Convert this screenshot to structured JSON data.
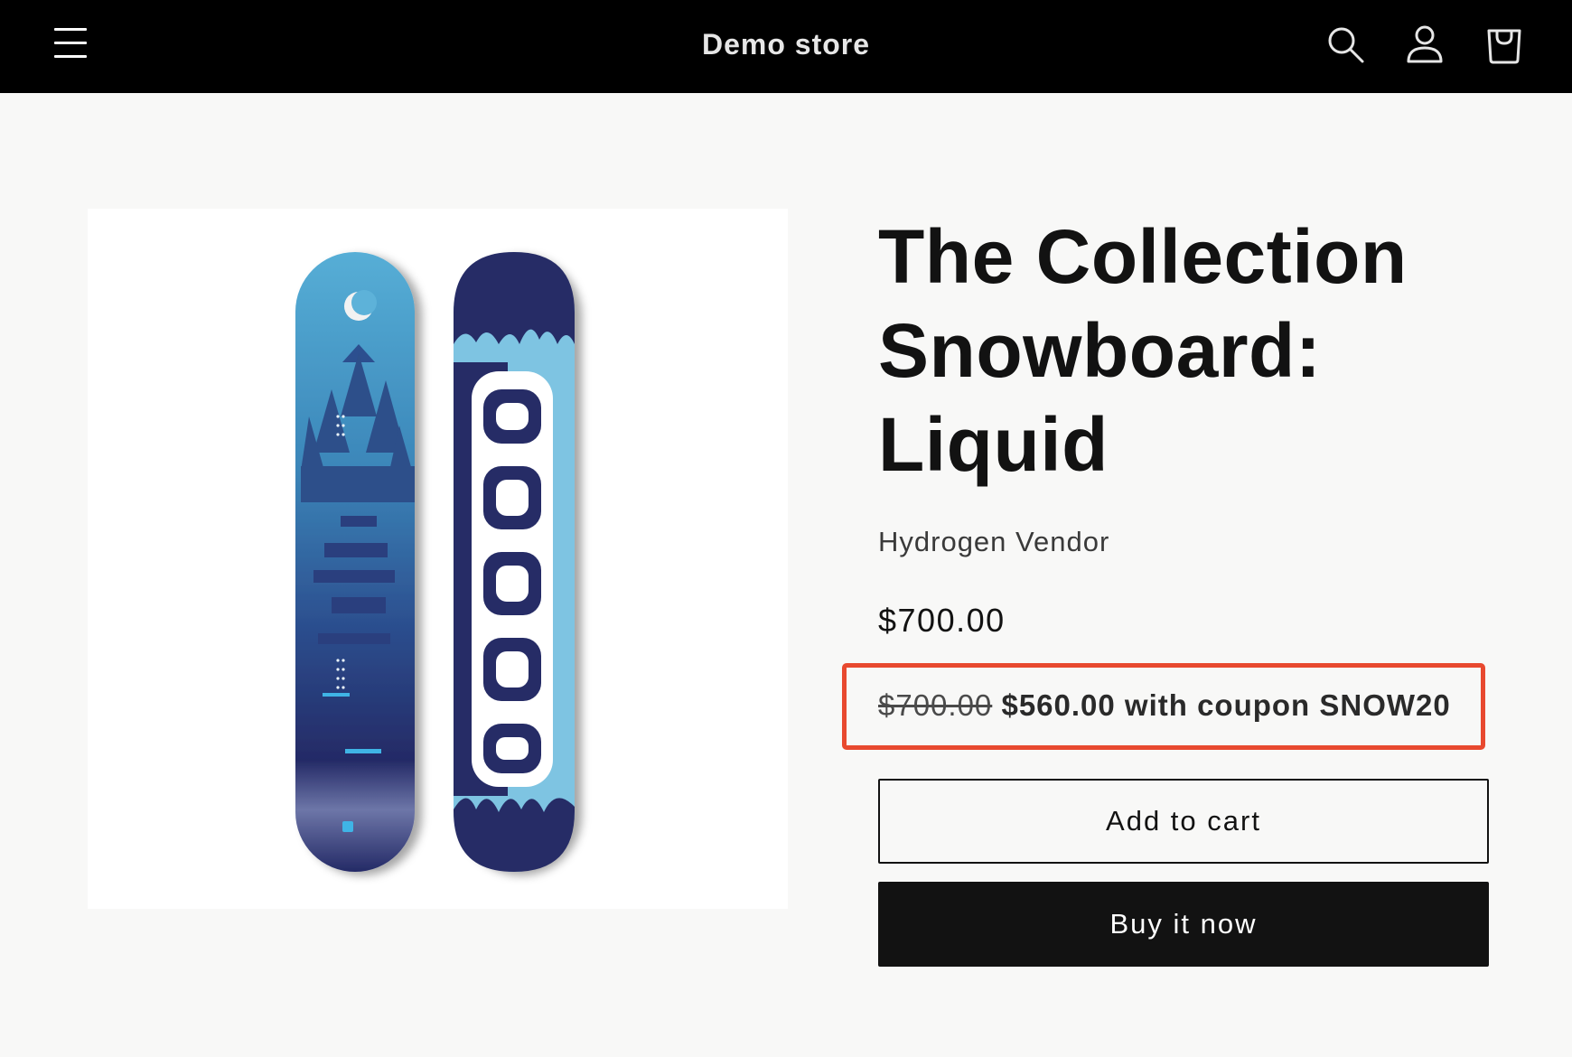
{
  "header": {
    "store_name": "Demo store",
    "menu_icon": "hamburger-menu-icon",
    "search_icon": "search-icon",
    "account_icon": "account-icon",
    "cart_icon": "cart-icon"
  },
  "product": {
    "image_alt": "The Collection Snowboard: Liquid",
    "title": "The Collection Snowboard: Liquid",
    "vendor": "Hydrogen Vendor",
    "price": "$700.00",
    "coupon": {
      "original_price": "$700.00",
      "discount_text": "$560.00 with coupon SNOW20",
      "highlight_color": "#e8492f"
    },
    "add_to_cart_label": "Add to cart",
    "buy_now_label": "Buy it now"
  },
  "colors": {
    "header_bg": "#000000",
    "page_bg": "#f8f8f7",
    "primary_button": "#121212",
    "board_dark": "#24285f",
    "board_light": "#6fb7d8"
  }
}
